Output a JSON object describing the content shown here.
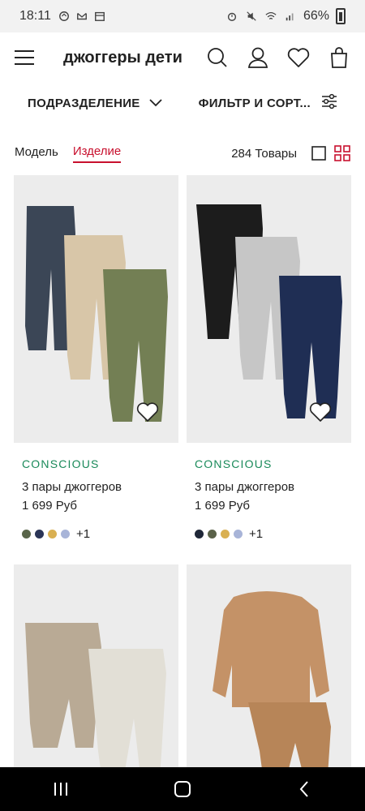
{
  "status": {
    "time": "18:11",
    "battery": "66%"
  },
  "header": {
    "title": "джоггеры дети",
    "icons": [
      "menu-icon",
      "search-icon",
      "account-icon",
      "favorites-icon",
      "bag-icon"
    ]
  },
  "filters": {
    "department": "ПОДРАЗДЕЛЕНИЕ",
    "filter_sort": "ФИЛЬТР И СОРТ..."
  },
  "view": {
    "tab_model": "Модель",
    "tab_product": "Изделие",
    "count": "284 Товары"
  },
  "products": [
    {
      "tag": "CONSCIOUS",
      "name": "3 пары джоггеров",
      "price": "1 699 Руб",
      "swatches": [
        "#59654a",
        "#2b3557",
        "#d9b052",
        "#a8b4d8"
      ],
      "more": "+1"
    },
    {
      "tag": "CONSCIOUS",
      "name": "3 пары джоггеров",
      "price": "1 699 Руб",
      "swatches": [
        "#1f2738",
        "#5a6249",
        "#d9b052",
        "#a8b4d8"
      ],
      "more": "+1"
    }
  ],
  "colors": {
    "accent": "#c8102e",
    "conscious": "#1a8a5a"
  }
}
